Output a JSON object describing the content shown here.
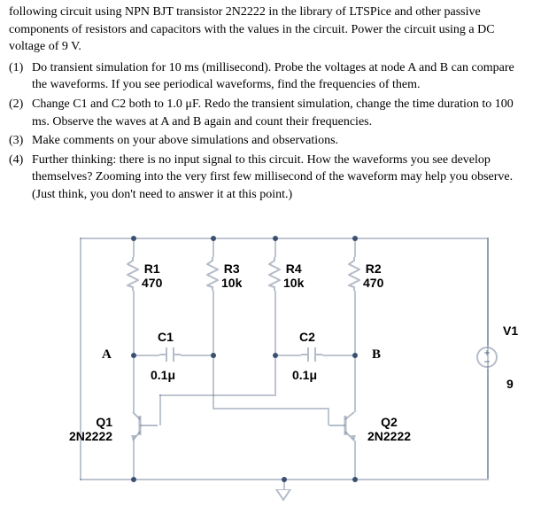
{
  "intro": "following circuit using NPN BJT transistor 2N2222 in the library of LTSPice and other passive components of resistors and capacitors with the values in the circuit. Power the circuit using a DC voltage of 9 V.",
  "questions": {
    "q1": {
      "num": "(1)",
      "text": "Do transient simulation for 10 ms (millisecond). Probe the voltages at node A and B can compare the waveforms. If you see periodical waveforms, find the frequencies of them."
    },
    "q2": {
      "num": "(2)",
      "text": "Change C1 and C2 both to 1.0 μF. Redo the transient simulation, change the time duration to 100 ms. Observe the waves at A and B again and count their frequencies."
    },
    "q3": {
      "num": "(3)",
      "text": "Make comments on your above simulations and observations."
    },
    "q4": {
      "num": "(4)",
      "text": "Further thinking: there is no input signal to this circuit. How the waveforms you see develop themselves? Zooming into the very first few millisecond of the waveform may help you observe. (Just think, you don't need to answer it at this point.)"
    }
  },
  "circuit": {
    "nodes": {
      "A": "A",
      "B": "B"
    },
    "components": {
      "R1": {
        "name": "R1",
        "value": "470"
      },
      "R2": {
        "name": "R2",
        "value": "470"
      },
      "R3": {
        "name": "R3",
        "value": "10k"
      },
      "R4": {
        "name": "R4",
        "value": "10k"
      },
      "C1": {
        "name": "C1",
        "value": "0.1μ"
      },
      "C2": {
        "name": "C2",
        "value": "0.1μ"
      },
      "Q1": {
        "name": "Q1",
        "value": "2N2222"
      },
      "Q2": {
        "name": "Q2",
        "value": "2N2222"
      },
      "V1": {
        "name": "V1",
        "value": "9"
      }
    }
  }
}
